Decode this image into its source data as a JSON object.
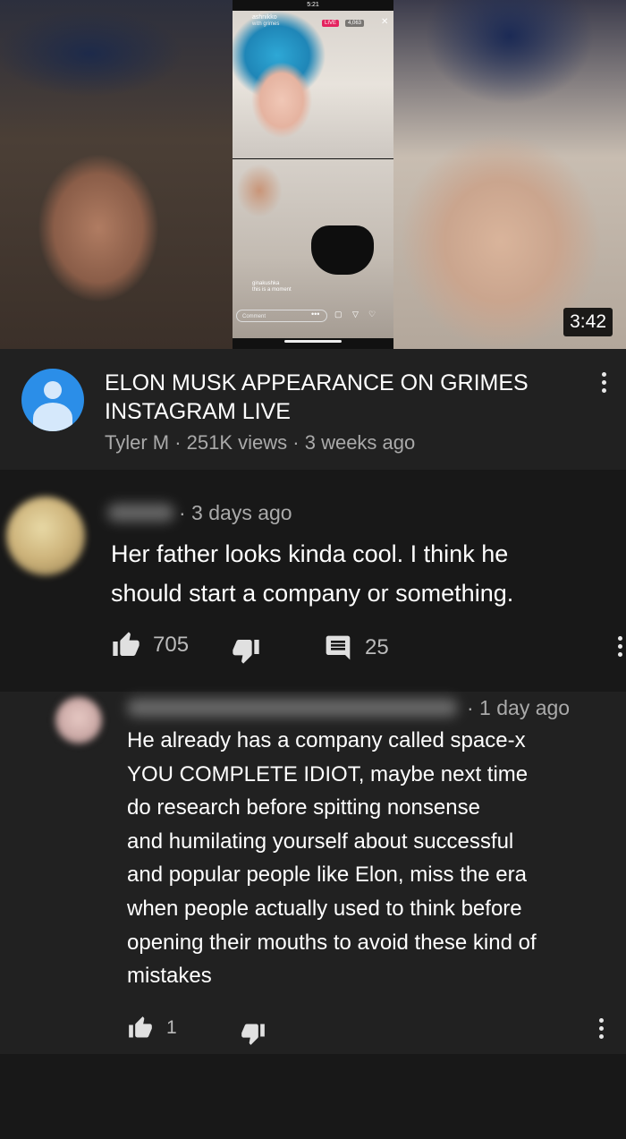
{
  "thumbnail": {
    "duration": "3:42",
    "phone_status_time": "5:21",
    "ig_username": "ashnikko",
    "ig_with": "with grimes",
    "live_badge": "LIVE",
    "viewer_count": "4,063",
    "guest_username": "ginakushka",
    "guest_note": "this is a moment",
    "comment_placeholder": "Comment"
  },
  "video": {
    "title": "ELON MUSK APPEARANCE ON GRIMES INSTAGRAM LIVE",
    "meta": "Tyler M · 251K views · 3 weeks ago",
    "channel_avatar_color": "#2b8ee8"
  },
  "comments": [
    {
      "time": "· 3 days ago",
      "text_line1": "Her father looks kinda cool. I think he",
      "text_line2": "should start a company or something.",
      "likes": "705",
      "replies": "25"
    },
    {
      "time": "· 1 day ago",
      "text": [
        "He already has a company called space-x",
        "YOU COMPLETE IDIOT, maybe next time",
        "do research before spitting nonsense",
        "and humilating yourself about successful",
        "and popular people like Elon, miss the era",
        "when people actually used to think before",
        "opening their mouths to avoid these kind of",
        "mistakes"
      ],
      "likes": "1"
    }
  ],
  "icons": {
    "like": "thumbs-up-icon",
    "dislike": "thumbs-down-icon",
    "reply": "comment-icon",
    "more": "more-vert-icon"
  }
}
